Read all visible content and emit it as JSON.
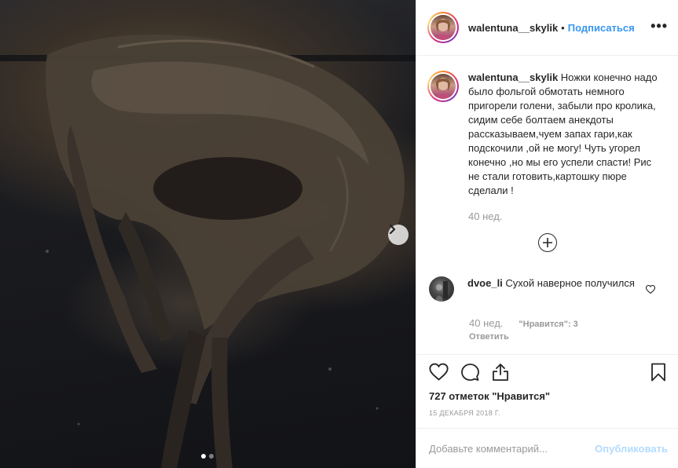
{
  "post": {
    "author": "walentuna__skylik",
    "separator": "•",
    "follow_label": "Подписаться",
    "more_label": "•••",
    "caption_text": "Ножки конечно надо было фольгой обмотать немного пригорели голени, забыли про кролика, сидим себе болтаем анекдоты рассказываем,чуем запах гари,как подскочили ,ой не могу! Чуть угорел конечно ,но мы его успели спасти! Рис не стали готовить,картошку пюре сделали !",
    "caption_time": "40 нед.",
    "likes_count": "727 отметок \"Нравится\"",
    "date": "15 ДЕКАБРЯ 2018 Г."
  },
  "carousel": {
    "slide_count": 2,
    "active_slide": 1
  },
  "comments": [
    {
      "username": "dvoe_li",
      "text": "Сухой наверное получился",
      "time": "40 нед.",
      "likes": "\"Нравится\": 3",
      "reply_label": "Ответить"
    }
  ],
  "add_comment": {
    "placeholder": "Добавьте комментарий...",
    "publish_label": "Опубликовать"
  },
  "icons": {
    "more": "more-dots-icon",
    "load_more": "plus-circle-icon",
    "like": "heart-icon",
    "comment": "comment-bubble-icon",
    "share": "share-icon",
    "save": "bookmark-icon",
    "next": "chevron-right-icon"
  },
  "colors": {
    "link_blue": "#3897f0",
    "publish_disabled": "#b3dbff",
    "muted_text": "#999999",
    "border": "#efefef"
  }
}
